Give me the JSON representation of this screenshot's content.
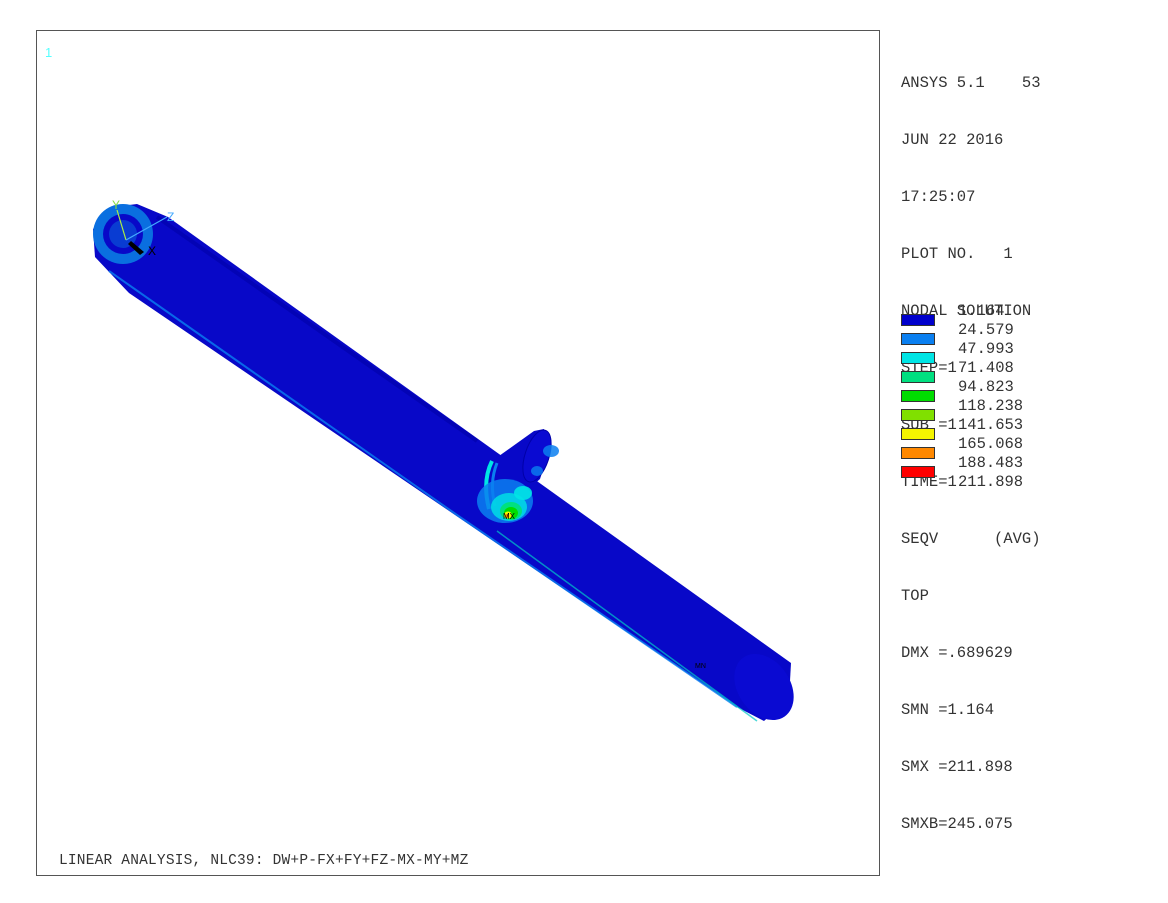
{
  "viewport": {
    "window_number": "1",
    "title_line": "LINEAR ANALYSIS, NLC39: DW+P-FX+FY+FZ-MX-MY+MZ",
    "triad": {
      "y_label": "Y",
      "z_label": "Z",
      "x_label": "X"
    },
    "mx_label": "MX",
    "mn_label": "MN"
  },
  "info": {
    "lines": [
      "ANSYS 5.1    53",
      "JUN 22 2016",
      "17:25:07",
      "PLOT NO.   1",
      "NODAL SOLUTION",
      "STEP=1",
      "SUB =1",
      "TIME=1",
      "SEQV      (AVG)",
      "TOP",
      "DMX =.689629",
      "SMN =1.164",
      "SMX =211.898",
      "SMXB=245.075"
    ]
  },
  "legend": {
    "values": [
      "1.164",
      "24.579",
      "47.993",
      "71.408",
      "94.823",
      "118.238",
      "141.653",
      "165.068",
      "188.483",
      "211.898"
    ],
    "colors": [
      "#0000cc",
      "#0a7ff0",
      "#00e5e5",
      "#00e080",
      "#00dd00",
      "#80e000",
      "#f5f500",
      "#ff8800",
      "#ff0000"
    ]
  }
}
